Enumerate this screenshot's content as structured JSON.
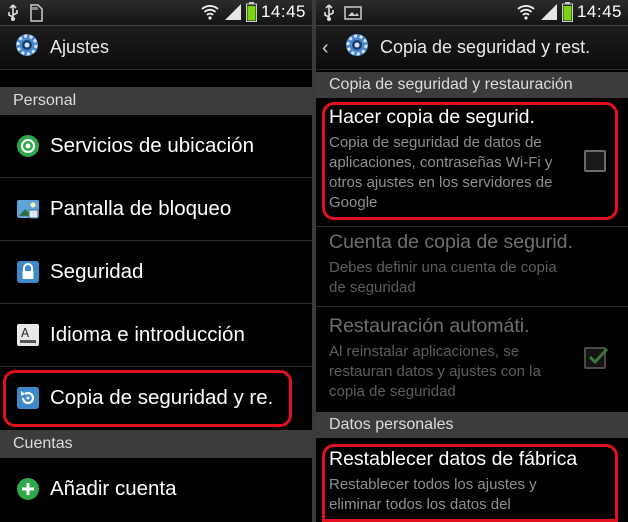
{
  "status_bar": {
    "time": "14:45",
    "battery_color": "#7bd312",
    "signal_color": "#e6e6e6"
  },
  "left": {
    "title": "Ajustes",
    "sections": {
      "personal": "Personal",
      "accounts": "Cuentas"
    },
    "items": [
      {
        "label": "Servicios de ubicación",
        "icon": "location-icon"
      },
      {
        "label": "Pantalla de bloqueo",
        "icon": "lock-screen-icon"
      },
      {
        "label": "Seguridad",
        "icon": "security-lock-icon"
      },
      {
        "label": "Idioma e introducción",
        "icon": "language-keyboard-icon"
      },
      {
        "label": "Copia de seguridad y re.",
        "icon": "backup-restore-icon",
        "highlighted": true
      }
    ],
    "accounts_items": [
      {
        "label": "Añadir cuenta",
        "icon": "add-account-icon"
      }
    ]
  },
  "right": {
    "title": "Copia de seguridad y rest.",
    "sections": {
      "backup": "Copia de seguridad y restauración",
      "personal_data": "Datos personales"
    },
    "prefs": [
      {
        "title": "Hacer copia de segurid.",
        "summary": "Copia de seguridad de datos de aplicaciones, contraseñas Wi-Fi y otros ajustes en los servidores de Google",
        "checked": false,
        "enabled": true,
        "highlighted": true
      },
      {
        "title": "Cuenta de copia de segurid.",
        "summary": "Debes definir una cuenta de copia de seguridad",
        "enabled": false
      },
      {
        "title": "Restauración automáti.",
        "summary": "Al reinstalar aplicaciones, se restauran datos y ajustes con la copia de seguridad",
        "checked": true,
        "enabled": false
      },
      {
        "title": "Restablecer datos de fábrica",
        "summary": "Restablecer todos los ajustes y eliminar todos los datos del",
        "enabled": true,
        "highlighted": true
      }
    ]
  },
  "colors": {
    "highlight": "#e3101d",
    "section_bg": "#3c3c3c",
    "accent_green": "#2fa84a"
  }
}
